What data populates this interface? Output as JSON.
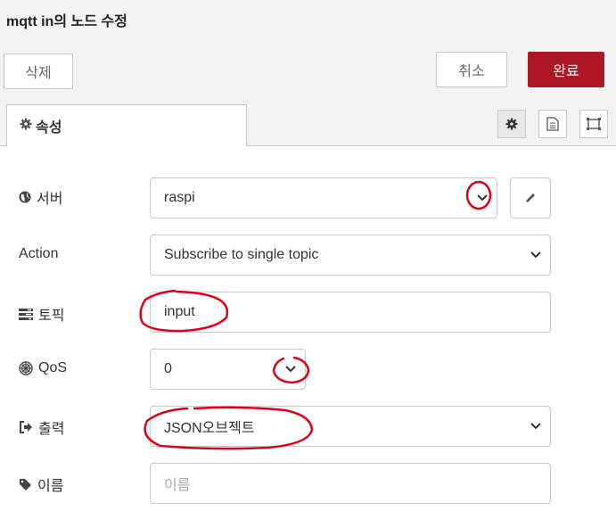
{
  "dialog": {
    "title": "mqtt in의 노드 수정"
  },
  "toolbar": {
    "delete_label": "삭제",
    "cancel_label": "취소",
    "done_label": "완료"
  },
  "tabs": {
    "properties_label": "속성"
  },
  "form": {
    "server": {
      "label": "서버",
      "value": "raspi"
    },
    "action": {
      "label": "Action",
      "value": "Subscribe to single topic"
    },
    "topic": {
      "label": "토픽",
      "value": "input"
    },
    "qos": {
      "label": "QoS",
      "value": "0"
    },
    "output": {
      "label": "출력",
      "value": "JSON오브젝트"
    },
    "name": {
      "label": "이름",
      "value": "",
      "placeholder": "이름"
    }
  },
  "colors": {
    "primary_button": "#ad1625",
    "annotation": "#e0001b"
  }
}
